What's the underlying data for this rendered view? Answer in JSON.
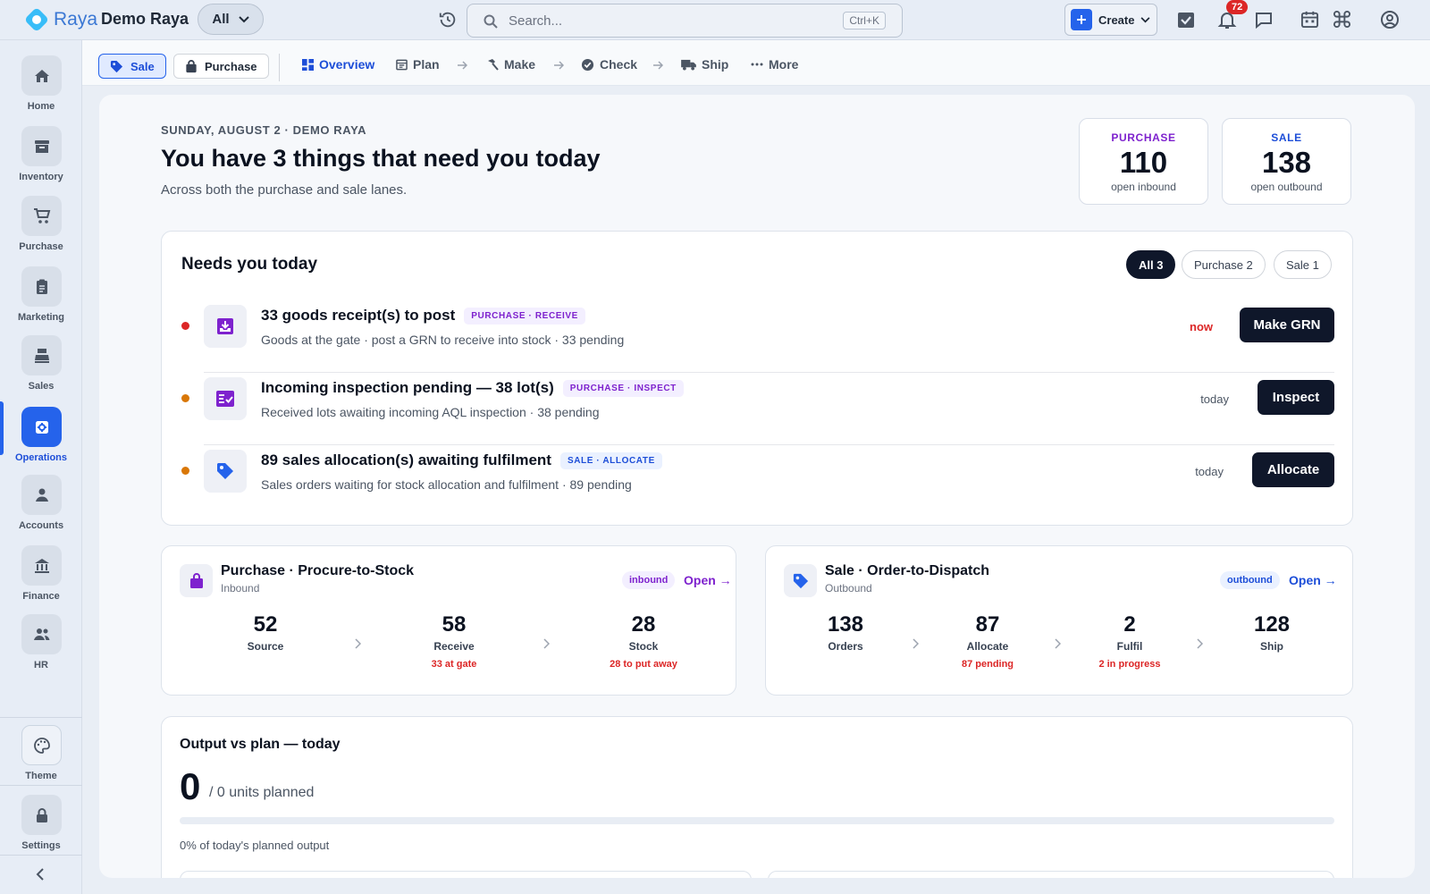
{
  "brand": {
    "logo_text": "Raya",
    "org_name": "Demo Raya",
    "scope_label": "All",
    "accent": "#2563eb"
  },
  "search": {
    "placeholder": "Search...",
    "shortcut": "Ctrl+K"
  },
  "topbar": {
    "create_label": "Create",
    "notification_count": "72",
    "icons": [
      "history-icon",
      "search-icon",
      "tasks-icon",
      "bell-icon",
      "chat-icon",
      "calendar-icon",
      "command-icon",
      "user-icon"
    ]
  },
  "sidebar": {
    "items": [
      {
        "label": "Home",
        "icon": "home-icon"
      },
      {
        "label": "Inventory",
        "icon": "archive-icon"
      },
      {
        "label": "Purchase",
        "icon": "cart-icon"
      },
      {
        "label": "Marketing",
        "icon": "clipboard-icon"
      },
      {
        "label": "Sales",
        "icon": "register-icon"
      },
      {
        "label": "Operations",
        "icon": "gear-icon",
        "active": true
      },
      {
        "label": "Accounts",
        "icon": "person-icon"
      },
      {
        "label": "Finance",
        "icon": "bank-icon"
      },
      {
        "label": "HR",
        "icon": "people-icon"
      }
    ],
    "bottom": [
      {
        "label": "Theme",
        "icon": "palette-icon"
      },
      {
        "label": "Settings",
        "icon": "lock-icon"
      }
    ]
  },
  "subnav": {
    "lanes": [
      {
        "label": "Sale",
        "active": true
      },
      {
        "label": "Purchase"
      }
    ],
    "tabs": [
      {
        "label": "Overview",
        "active": true
      },
      {
        "label": "Plan"
      },
      {
        "label": "Make"
      },
      {
        "label": "Check"
      },
      {
        "label": "Ship"
      },
      {
        "label": "More"
      }
    ]
  },
  "header": {
    "date_line": "SUNDAY, AUGUST 2 · DEMO RAYA",
    "headline": "You have 3 things that need you today",
    "subline": "Across both the purchase and sale lanes."
  },
  "stats": [
    {
      "label": "PURCHASE",
      "value": "110",
      "sub": "open inbound",
      "color": "#7e22ce"
    },
    {
      "label": "SALE",
      "value": "138",
      "sub": "open outbound",
      "color": "#1d4ed8"
    }
  ],
  "needs": {
    "title": "Needs you today",
    "filters": [
      {
        "label": "All 3",
        "active": true
      },
      {
        "label": "Purchase 2"
      },
      {
        "label": "Sale 1"
      }
    ],
    "tasks": [
      {
        "title": "33 goods receipt(s) to post",
        "tag": "PURCHASE · RECEIVE",
        "desc": "Goods at the gate · post a GRN to receive into stock · 33 pending",
        "when": "now",
        "action": "Make GRN",
        "dot": "#dc2626",
        "icon": "inbox-icon"
      },
      {
        "title": "Incoming inspection pending — 38 lot(s)",
        "tag": "PURCHASE · INSPECT",
        "desc": "Received lots awaiting incoming AQL inspection · 38 pending",
        "when": "today",
        "action": "Inspect",
        "dot": "#d97706",
        "icon": "checklist-icon"
      },
      {
        "title": "89 sales allocation(s) awaiting fulfilment",
        "tag": "SALE · ALLOCATE",
        "desc": "Sales orders waiting for stock allocation and fulfilment · 89 pending",
        "when": "today",
        "action": "Allocate",
        "dot": "#d97706",
        "icon": "tag-icon"
      }
    ]
  },
  "purchase_flow": {
    "title": "Purchase · Procure-to-Stock",
    "subtitle": "Inbound",
    "badge": "inbound",
    "open": "Open →",
    "steps": [
      {
        "value": "52",
        "label": "Source",
        "note": ""
      },
      {
        "value": "58",
        "label": "Receive",
        "note": "33 at gate"
      },
      {
        "value": "28",
        "label": "Stock",
        "note": "28 to put away"
      }
    ]
  },
  "sale_flow": {
    "title": "Sale · Order-to-Dispatch",
    "subtitle": "Outbound",
    "badge": "outbound",
    "open": "Open →",
    "steps": [
      {
        "value": "138",
        "label": "Orders",
        "note": ""
      },
      {
        "value": "87",
        "label": "Allocate",
        "note": "87 pending"
      },
      {
        "value": "2",
        "label": "Fulfil",
        "note": "2 in progress"
      },
      {
        "value": "128",
        "label": "Ship",
        "note": ""
      }
    ]
  },
  "output": {
    "title": "Output vs plan — today",
    "value": "0",
    "planned": "/ 0 units planned",
    "percent_text": "0% of today's planned output",
    "progress": 0
  }
}
